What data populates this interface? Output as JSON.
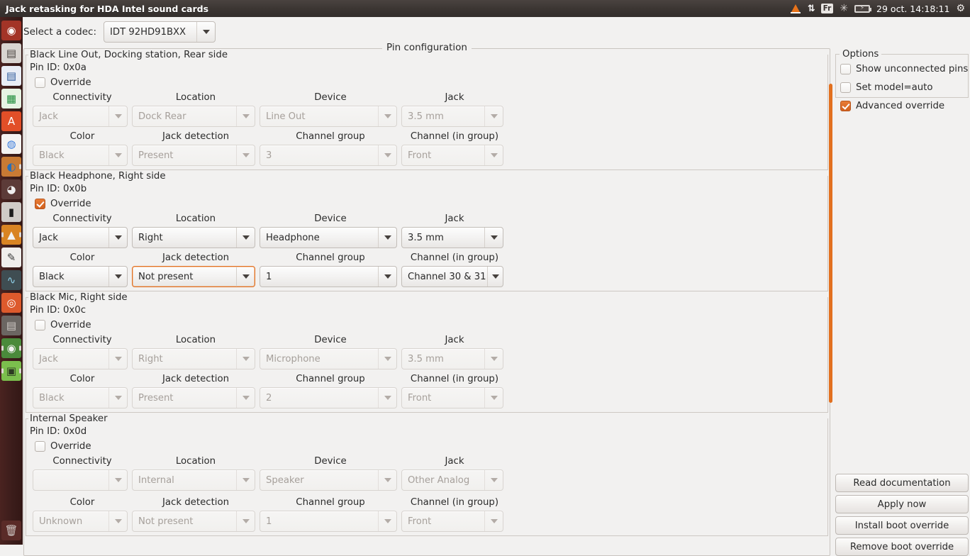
{
  "window": {
    "title": "Jack retasking for HDA Intel sound cards"
  },
  "tray": {
    "vlc_icon": "vlc-cone-icon",
    "network_icon": "network-up-down-icon",
    "keyboard_layout": "Fr",
    "bluetooth_icon": "bluetooth-icon",
    "battery_icon": "battery-charging-icon",
    "clock": "29 oct. 14:18:11",
    "session_icon": "gear-icon"
  },
  "launcher": {
    "items": [
      {
        "name": "ubuntu-dash-icon",
        "glyph": "◉",
        "bg": "#a33427",
        "fg": "#ffffff",
        "pip_left": false,
        "pip_right": false
      },
      {
        "name": "files-nautilus-icon",
        "glyph": "▤",
        "bg": "#d9d5d1",
        "fg": "#4a4440",
        "pip_left": false,
        "pip_right": false
      },
      {
        "name": "libreoffice-writer-icon",
        "glyph": "▤",
        "bg": "#e9edf5",
        "fg": "#2a5699",
        "pip_left": false,
        "pip_right": false
      },
      {
        "name": "libreoffice-calc-icon",
        "glyph": "▦",
        "bg": "#e7f3e3",
        "fg": "#1e8c3a",
        "pip_left": false,
        "pip_right": false
      },
      {
        "name": "ubuntu-software-center-icon",
        "glyph": "A",
        "bg": "#e24f28",
        "fg": "#ffffff",
        "pip_left": false,
        "pip_right": false
      },
      {
        "name": "google-chrome-icon",
        "glyph": "◍",
        "bg": "#f5f3f1",
        "fg": "#3b7ddd",
        "pip_left": false,
        "pip_right": false
      },
      {
        "name": "firefox-icon",
        "glyph": "◐",
        "bg": "#c87a34",
        "fg": "#2a6fb8",
        "pip_left": false,
        "pip_right": true
      },
      {
        "name": "gimp-icon",
        "glyph": "◕",
        "bg": "#5c3b38",
        "fg": "#efefef",
        "pip_left": false,
        "pip_right": false
      },
      {
        "name": "terminal-icon",
        "glyph": "▮",
        "bg": "#cfcbc7",
        "fg": "#1c1c1c",
        "pip_left": false,
        "pip_right": false
      },
      {
        "name": "vlc-media-player-icon",
        "glyph": "▲",
        "bg": "#d98423",
        "fg": "#f3f3f3",
        "pip_left": true,
        "pip_right": true
      },
      {
        "name": "text-editor-icon",
        "glyph": "✎",
        "bg": "#f0eeec",
        "fg": "#3a3a3a",
        "pip_left": false,
        "pip_right": false
      },
      {
        "name": "audio-tool-icon",
        "glyph": "∿",
        "bg": "#3f4d52",
        "fg": "#8fd0e8",
        "pip_left": false,
        "pip_right": false
      },
      {
        "name": "sound-recorder-icon",
        "glyph": "◎",
        "bg": "#dd5a2c",
        "fg": "#ffffff",
        "pip_left": false,
        "pip_right": false
      },
      {
        "name": "keyboard-icon",
        "glyph": "▤",
        "bg": "#6b6662",
        "fg": "#cfcac6",
        "pip_left": false,
        "pip_right": false
      },
      {
        "name": "audacity-icon",
        "glyph": "◉",
        "bg": "#4a8a3b",
        "fg": "#f2f2f2",
        "pip_left": true,
        "pip_right": true
      },
      {
        "name": "hda-jack-retask-icon",
        "glyph": "▣",
        "bg": "#7bbf4d",
        "fg": "#2d3b22",
        "pip_left": true,
        "pip_right": true
      }
    ],
    "trash": {
      "name": "trash-icon",
      "glyph": "🗑",
      "bg": "#5a2b28",
      "fg": "#cfc7c4"
    }
  },
  "toolbar": {
    "codec_label": "Select a codec:",
    "codec_value": "IDT 92HD91BXX"
  },
  "pin_configuration": {
    "legend": "Pin configuration",
    "column_headers_row1": [
      "Connectivity",
      "Location",
      "Device",
      "Jack"
    ],
    "column_headers_row2": [
      "Color",
      "Jack detection",
      "Channel group",
      "Channel (in group)"
    ],
    "override_label": "Override",
    "groups": [
      {
        "title": "Black Line Out, Docking station, Rear side",
        "pin_id": "Pin ID: 0x0a",
        "override": false,
        "enabled": false,
        "connectivity": "Jack",
        "location": "Dock Rear",
        "device": "Line Out",
        "jack": "3.5 mm",
        "color": "Black",
        "jack_detection": "Present",
        "channel_group": "3",
        "channel_in_group": "Front",
        "focused_field": ""
      },
      {
        "title": "Black Headphone, Right side",
        "pin_id": "Pin ID: 0x0b",
        "override": true,
        "enabled": true,
        "connectivity": "Jack",
        "location": "Right",
        "device": "Headphone",
        "jack": "3.5 mm",
        "color": "Black",
        "jack_detection": "Not present",
        "channel_group": "1",
        "channel_in_group": "Channel 30 & 31",
        "focused_field": "jack_detection"
      },
      {
        "title": "Black Mic, Right side",
        "pin_id": "Pin ID: 0x0c",
        "override": false,
        "enabled": false,
        "connectivity": "Jack",
        "location": "Right",
        "device": "Microphone",
        "jack": "3.5 mm",
        "color": "Black",
        "jack_detection": "Present",
        "channel_group": "2",
        "channel_in_group": "Front",
        "focused_field": ""
      },
      {
        "title": "Internal Speaker",
        "pin_id": "Pin ID: 0x0d",
        "override": false,
        "enabled": false,
        "connectivity": "",
        "location": "Internal",
        "device": "Speaker",
        "jack": "Other Analog",
        "color": "Unknown",
        "jack_detection": "Not present",
        "channel_group": "1",
        "channel_in_group": "Front",
        "focused_field": ""
      }
    ]
  },
  "options": {
    "legend": "Options",
    "items": [
      {
        "label": "Show unconnected pins",
        "checked": false,
        "name": "show-unconnected-pins-checkbox"
      },
      {
        "label": "Set model=auto",
        "checked": false,
        "name": "set-model-auto-checkbox"
      },
      {
        "label": "Advanced override",
        "checked": true,
        "name": "advanced-override-checkbox"
      }
    ]
  },
  "buttons": [
    {
      "label": "Read documentation",
      "name": "read-documentation-button"
    },
    {
      "label": "Apply now",
      "name": "apply-now-button"
    },
    {
      "label": "Install boot override",
      "name": "install-boot-override-button"
    },
    {
      "label": "Remove boot override",
      "name": "remove-boot-override-button"
    }
  ],
  "colors": {
    "accent_orange": "#e2701f",
    "panel_dark": "#3c3633",
    "launcher_bg": "#3a1c1a",
    "window_bg": "#f2f1f0"
  }
}
